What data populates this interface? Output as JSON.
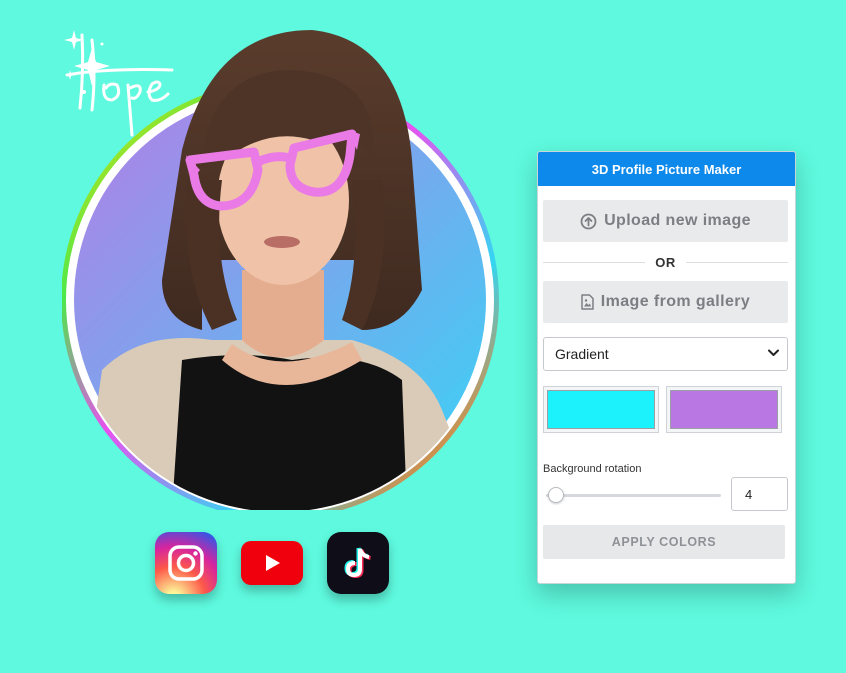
{
  "panel": {
    "title": "3D Profile Picture Maker",
    "upload_label": "Upload new image",
    "or_label": "OR",
    "gallery_label": "Image from gallery",
    "background_type": "Gradient",
    "color_1": "#1cf2fb",
    "color_2": "#b877e3",
    "rotation_label": "Background rotation",
    "rotation_value": "4",
    "apply_label": "APPLY COLORS"
  },
  "avatar": {
    "signature_text": "Hope",
    "gradient_top": "#b47ee6",
    "gradient_bottom": "#36d5f6"
  },
  "social": [
    {
      "name": "instagram-icon"
    },
    {
      "name": "youtube-icon"
    },
    {
      "name": "tiktok-icon"
    }
  ],
  "colors": {
    "background": "#5ef9de",
    "header": "#0c89ea",
    "glasses": "#ea7be6"
  }
}
